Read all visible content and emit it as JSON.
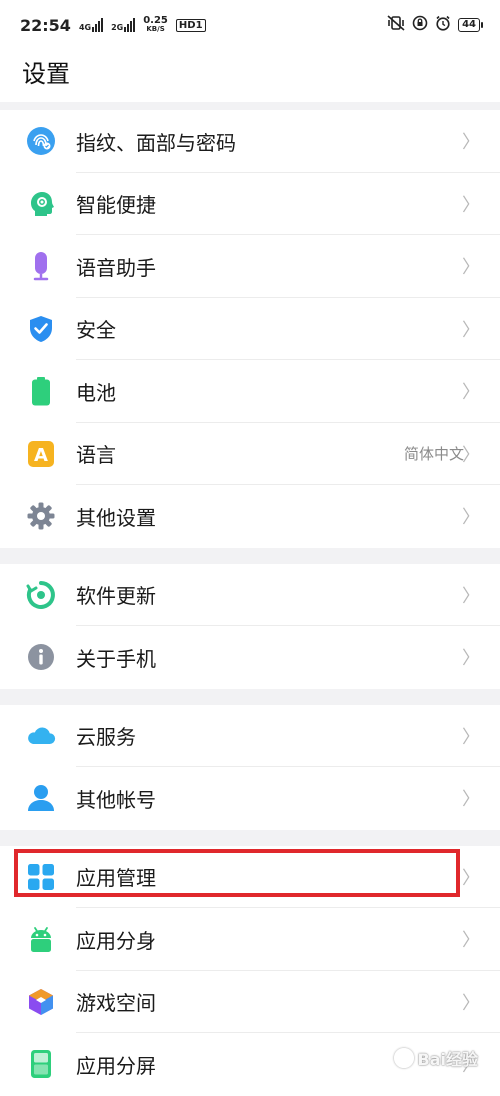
{
  "status_bar": {
    "time": "22:54",
    "net1": "4G",
    "net2": "2G",
    "speed_value": "0.25",
    "speed_unit": "KB/S",
    "hd": "HD1",
    "battery": "44"
  },
  "page_title": "设置",
  "groups": [
    [
      {
        "label": "指纹、面部与密码",
        "icon": "fingerprint-icon",
        "color": "#3aa0f0"
      },
      {
        "label": "智能便捷",
        "icon": "smart-assist-icon",
        "color": "#2ec48a"
      },
      {
        "label": "语音助手",
        "icon": "microphone-icon",
        "color": "#a070ee"
      },
      {
        "label": "安全",
        "icon": "shield-icon",
        "color": "#2a8ef0"
      },
      {
        "label": "电池",
        "icon": "battery-icon",
        "color": "#2ecf7c"
      },
      {
        "label": "语言",
        "icon": "language-icon",
        "color": "#f6b320",
        "value": "简体中文"
      },
      {
        "label": "其他设置",
        "icon": "gear-icon",
        "color": "#7d8594"
      }
    ],
    [
      {
        "label": "软件更新",
        "icon": "update-icon",
        "color": "#2ec48a"
      },
      {
        "label": "关于手机",
        "icon": "info-icon",
        "color": "#8c93a0"
      }
    ],
    [
      {
        "label": "云服务",
        "icon": "cloud-icon",
        "color": "#34b2f0"
      },
      {
        "label": "其他帐号",
        "icon": "person-icon",
        "color": "#2a9ef0"
      }
    ],
    [
      {
        "label": "应用管理",
        "icon": "apps-grid-icon",
        "color": "#2aa8f0"
      },
      {
        "label": "应用分身",
        "icon": "android-icon",
        "color": "#2ecf7c"
      },
      {
        "label": "游戏空间",
        "icon": "game-cube-icon",
        "color": "#8a4cf0"
      },
      {
        "label": "应用分屏",
        "icon": "split-screen-icon",
        "color": "#2ecf7c"
      }
    ]
  ],
  "watermark": "Bai经验",
  "chevron": "〉"
}
